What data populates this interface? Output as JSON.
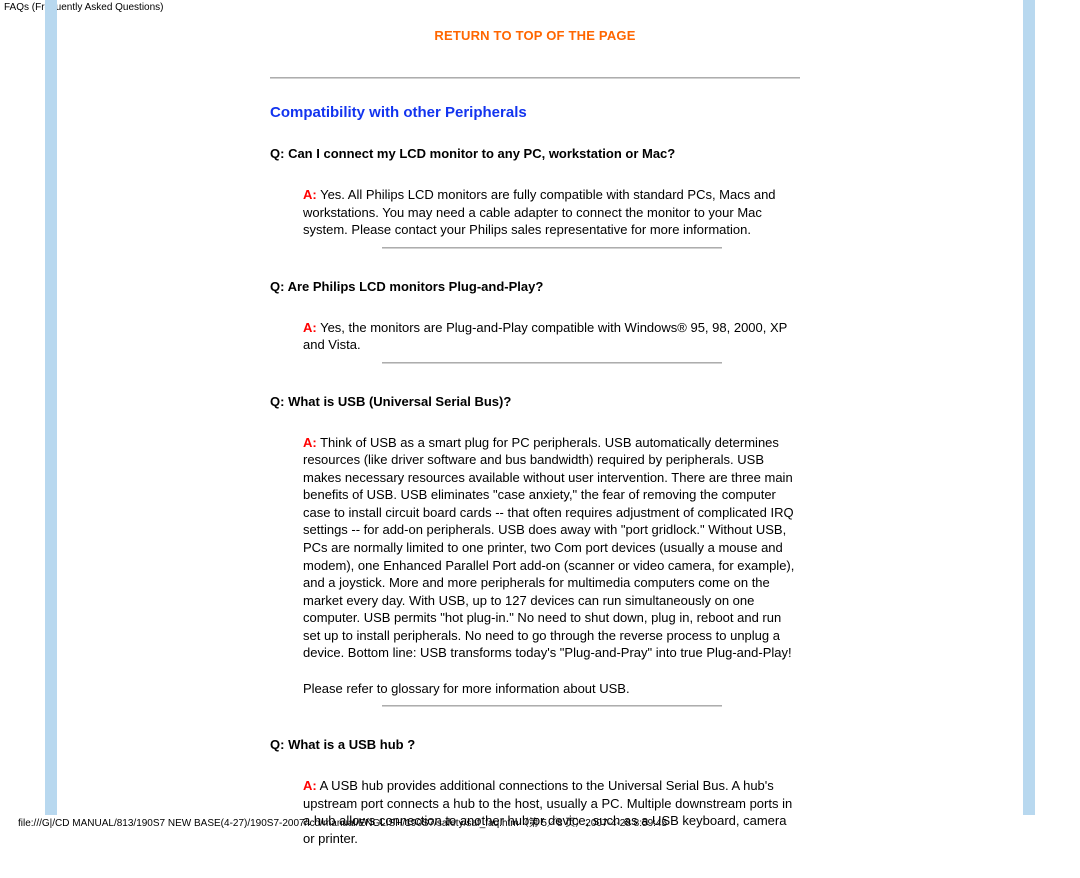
{
  "tabTitle": "FAQs (Frequently Asked Questions)",
  "topLink": "RETURN TO TOP OF THE PAGE",
  "sectionTitle": "Compatibility with other Peripherals",
  "qLabel": "Q:",
  "aLabel": "A:",
  "faqs": {
    "0": {
      "q": " Can I connect my LCD monitor to any PC, workstation or Mac?",
      "a": " Yes. All Philips LCD monitors are fully compatible with standard PCs, Macs and workstations. You may need a cable adapter to connect the monitor to your Mac system. Please contact your Philips sales representative for more information."
    },
    "1": {
      "q": " Are Philips LCD monitors Plug-and-Play?",
      "a": " Yes, the monitors are Plug-and-Play compatible with Windows® 95, 98, 2000,  XP and Vista."
    },
    "2": {
      "q": " What is USB (Universal Serial Bus)?",
      "a": " Think of USB as a smart plug for PC peripherals. USB automatically determines resources (like driver software and bus bandwidth) required by peripherals. USB makes necessary resources available without user intervention. There are three main benefits of USB. USB eliminates \"case anxiety,\" the fear of removing the computer case to install circuit board cards -- that often requires adjustment of complicated IRQ settings -- for add-on peripherals. USB does away with \"port gridlock.\" Without USB, PCs are normally limited to one printer, two Com port devices (usually a mouse and modem), one Enhanced Parallel Port add-on (scanner or video camera, for example), and a joystick. More and more peripherals for multimedia computers come on the market every day. With USB, up to 127 devices can run simultaneously on one computer. USB permits \"hot plug-in.\" No need to shut down, plug in, reboot and run set up to install peripherals. No need to go through the reverse process to unplug a device. Bottom line: USB transforms today's \"Plug-and-Pray\" into true Plug-and-Play!",
      "note": "Please refer to glossary for more information about USB."
    },
    "3": {
      "q": " What is a USB hub ?",
      "a": " A USB hub provides additional connections to the Universal Serial Bus. A hub's upstream port connects a hub to the host, usually a PC. Multiple downstream ports in a hub allows connection to another hub or device, such as a USB keyboard, camera or printer."
    }
  },
  "statusBar": "file:///G|/CD MANUAL/813/190S7 NEW BASE(4-27)/190S7-2007/lcd/manual/ENGLISH/190S7/safety/saf_faq.htm（第 5／8 页）2007-4-28 8:59:45"
}
